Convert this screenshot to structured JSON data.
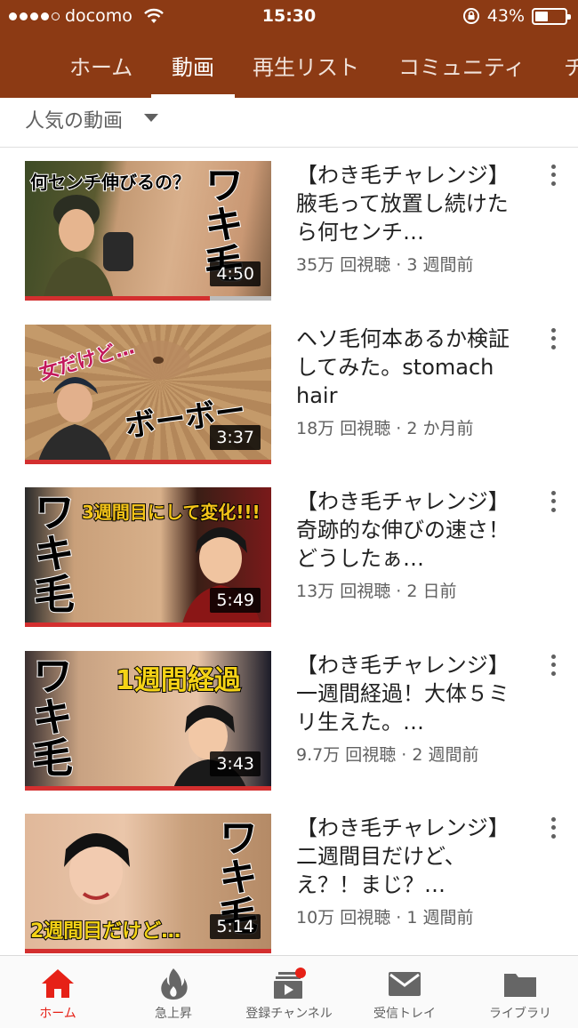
{
  "status_bar": {
    "carrier": "docomo",
    "time": "15:30",
    "battery": "43%",
    "battery_level": 0.43
  },
  "tabs": [
    {
      "label": "ホーム",
      "active": false
    },
    {
      "label": "動画",
      "active": true
    },
    {
      "label": "再生リスト",
      "active": false
    },
    {
      "label": "コミュニティ",
      "active": false
    },
    {
      "label": "チ",
      "active": false
    }
  ],
  "sort": {
    "label": "人気の動画"
  },
  "videos": [
    {
      "title": "【わき毛チャレンジ】腋毛って放置し続けたら何センチ…",
      "views": "35万 回視聴",
      "age": "3 週間前",
      "duration": "4:50",
      "overlay": [
        "何センチ伸びるの？",
        "ワキ毛"
      ],
      "watched_fraction": 0.75
    },
    {
      "title": "ヘソ毛何本あるか検証してみた。stomach hair",
      "views": "18万 回視聴",
      "age": "2 か月前",
      "duration": "3:37",
      "overlay": [
        "女だけど…",
        "ボーボー"
      ],
      "watched_fraction": 1.0
    },
    {
      "title": "【わき毛チャレンジ】奇跡的な伸びの速さ！どうしたぁ…",
      "views": "13万 回視聴",
      "age": "2 日前",
      "duration": "5:49",
      "overlay": [
        "3週間目にして変化!!!",
        "ワキ毛"
      ],
      "watched_fraction": 1.0
    },
    {
      "title": "【わき毛チャレンジ】一週間経過！大体５ミリ生えた。…",
      "views": "9.7万 回視聴",
      "age": "2 週間前",
      "duration": "3:43",
      "overlay": [
        "1週間経過",
        "ワキ毛"
      ],
      "watched_fraction": 1.0
    },
    {
      "title": "【わき毛チャレンジ】二週間目だけど、え？！まじ？…",
      "views": "10万 回視聴",
      "age": "1 週間前",
      "duration": "5:14",
      "overlay": [
        "2週間目だけど…",
        "ワキ毛"
      ],
      "watched_fraction": 1.0
    }
  ],
  "bottom_nav": [
    {
      "label": "ホーム",
      "icon": "home-icon",
      "active": true
    },
    {
      "label": "急上昇",
      "icon": "flame-icon",
      "active": false
    },
    {
      "label": "登録チャンネル",
      "icon": "subscriptions-icon",
      "active": false
    },
    {
      "label": "受信トレイ",
      "icon": "mail-icon",
      "active": false
    },
    {
      "label": "ライブラリ",
      "icon": "folder-icon",
      "active": false
    }
  ],
  "colors": {
    "header": "#8c3a14",
    "accent": "#e62117",
    "progress": "#d32f2f"
  }
}
